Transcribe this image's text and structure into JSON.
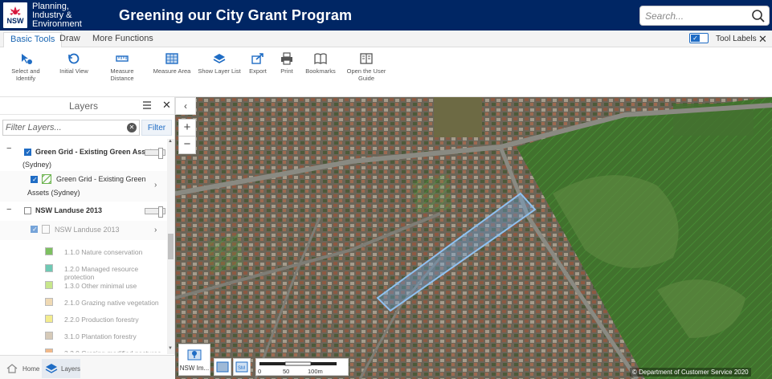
{
  "header": {
    "logo_nsw": "NSW",
    "logo_line1": "Planning,",
    "logo_line2": "Industry &",
    "logo_line3": "Environment",
    "title": "Greening our City Grant Program",
    "search_placeholder": "Search..."
  },
  "tabs": [
    {
      "label": "Basic Tools",
      "active": true
    },
    {
      "label": "Draw",
      "active": false
    },
    {
      "label": "More Functions",
      "active": false
    }
  ],
  "tool_labels_toggle": {
    "label": "Tool Labels",
    "on": true
  },
  "toolbar": [
    {
      "label_line1": "Select and",
      "label_line2": "Identify",
      "icon": "select-icon"
    },
    {
      "label_line1": "Initial View",
      "label_line2": "",
      "icon": "refresh-icon"
    },
    {
      "label_line1": "Measure",
      "label_line2": "Distance",
      "icon": "ruler-icon"
    },
    {
      "label_line1": "Measure Area",
      "label_line2": "",
      "icon": "area-icon"
    },
    {
      "label_line1": "Show Layer List",
      "label_line2": "",
      "icon": "layers-icon"
    },
    {
      "label_line1": "Export",
      "label_line2": "",
      "icon": "export-icon"
    },
    {
      "label_line1": "Print",
      "label_line2": "",
      "icon": "print-icon"
    },
    {
      "label_line1": "Bookmarks",
      "label_line2": "",
      "icon": "book-icon"
    },
    {
      "label_line1": "Open the User",
      "label_line2": "Guide",
      "icon": "guide-icon"
    }
  ],
  "layers_panel": {
    "title": "Layers",
    "filter_placeholder": "Filter Layers...",
    "filter_button": "Filter",
    "layers": [
      {
        "name_line1": "Green Grid - Existing Green Assets",
        "name_line2": "(Sydney)",
        "checked": true
      },
      {
        "name_line1": "Green Grid - Existing Green",
        "name_line2": "Assets (Sydney)",
        "checked": true
      },
      {
        "name_line1": "NSW Landuse 2013",
        "name_line2": "",
        "checked": false
      },
      {
        "name_line1": "NSW Landuse 2013",
        "name_line2": "",
        "checked": true
      }
    ],
    "legend": [
      {
        "label": "1.1.0 Nature conservation",
        "color": "#7dc061"
      },
      {
        "label": "1.2.0 Managed resource protection",
        "color": "#6fc9b4"
      },
      {
        "label": "1.3.0 Other minimal use",
        "color": "#c7e68b"
      },
      {
        "label": "2.1.0 Grazing native vegetation",
        "color": "#efd9b3"
      },
      {
        "label": "2.2.0 Production forestry",
        "color": "#f3ec8e"
      },
      {
        "label": "3.1.0 Plantation forestry",
        "color": "#d6cab8"
      },
      {
        "label": "3.2.0 Grazing modified pastures",
        "color": "#f0b88a"
      }
    ],
    "footer_tabs": [
      {
        "label": "Home",
        "active": false
      },
      {
        "label": "Layers",
        "active": true
      }
    ]
  },
  "map": {
    "basemap_label": "NSW Im...",
    "scale_labels": [
      "0",
      "50",
      "100m"
    ],
    "copyright": "© Department of Customer Service 2020"
  }
}
